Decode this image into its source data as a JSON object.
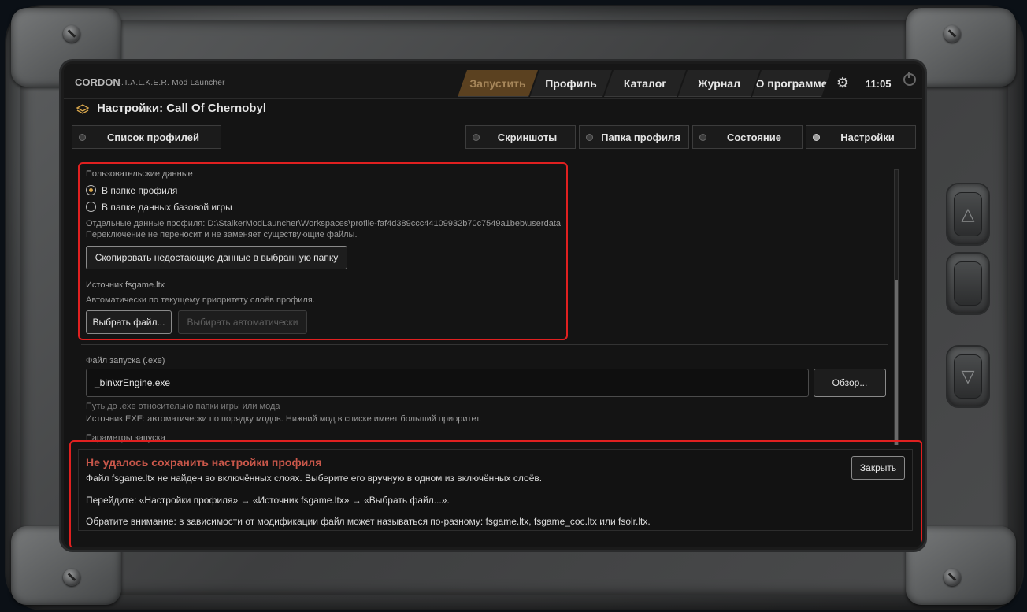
{
  "app": {
    "brand": "CORDON",
    "subtitle": "S.T.A.L.K.E.R. Mod Launcher",
    "clock": "11:05",
    "nav": [
      {
        "label": "Запустить"
      },
      {
        "label": "Профиль"
      },
      {
        "label": "Каталог"
      },
      {
        "label": "Журнал"
      },
      {
        "label": "О программе"
      }
    ]
  },
  "page": {
    "title": "Настройки: Call Of Chernobyl"
  },
  "tabs": {
    "profiles_list": "Список профилей",
    "screenshots": "Скриншоты",
    "profile_folder": "Папка профиля",
    "status": "Состояние",
    "settings": "Настройки"
  },
  "user_data": {
    "section_label": "Пользовательские данные",
    "option_profile_folder": "В папке профиля",
    "option_base_game": "В папке данных базовой игры",
    "path_line": "Отдельные данные профиля: D:\\StalkerModLauncher\\Workspaces\\profile-faf4d389ccc44109932b70c7549a1beb\\userdata",
    "note": "Переключение не переносит и не заменяет существующие файлы.",
    "copy_button": "Скопировать недостающие данные в выбранную папку",
    "fsgame_label": "Источник fsgame.ltx",
    "fsgame_note": "Автоматически по текущему приоритету слоёв профиля.",
    "choose_file_button": "Выбрать файл...",
    "auto_button": "Выбирать автоматически"
  },
  "exe": {
    "label": "Файл запуска (.exe)",
    "value": "_bin\\xrEngine.exe",
    "browse_button": "Обзор...",
    "hint1": "Путь до .exe относительно папки игры или мода",
    "hint2": "Источник EXE: автоматически по порядку модов. Нижний мод в списке имеет больший приоритет.",
    "params_label": "Параметры запуска"
  },
  "error_toast": {
    "title": "Не удалось сохранить настройки профиля",
    "line1": "Файл fsgame.ltx не найден во включённых слоях. Выберите его вручную в одном из включённых слоёв.",
    "line2": "Перейдите: «Настройки профиля» → «Источник fsgame.ltx» → «Выбрать файл...».",
    "line3": "Обратите внимание: в зависимости от модификации файл может называться по-разному: fsgame.ltx, fsgame_coc.ltx или fsolr.ltx.",
    "close_button": "Закрыть"
  },
  "colors": {
    "accent": "#d7a54b",
    "active_tab": "#5b4120",
    "error": "#c9574a",
    "highlight": "#e02020"
  }
}
